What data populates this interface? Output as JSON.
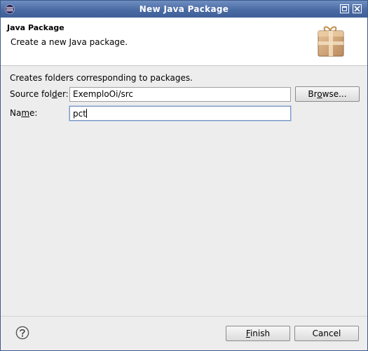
{
  "window": {
    "title": "New Java Package",
    "app_icon": "eclipse-icon",
    "maximize_icon": "maximize-icon",
    "close_icon": "close-icon"
  },
  "header": {
    "title": "Java Package",
    "description": "Create a new Java package.",
    "icon": "package-icon"
  },
  "form": {
    "intro": "Creates folders corresponding to packages.",
    "source_folder": {
      "label_pre": "Source fol",
      "label_mnemonic": "d",
      "label_post": "er:",
      "value": "ExemploOi/src"
    },
    "name": {
      "label_pre": "Na",
      "label_mnemonic": "m",
      "label_post": "e:",
      "value": "pct"
    },
    "browse_button": {
      "pre": "Br",
      "mnemonic": "o",
      "post": "wse..."
    }
  },
  "footer": {
    "help_icon": "help-icon",
    "finish_button": {
      "mnemonic": "F",
      "post": "inish"
    },
    "cancel_button": "Cancel"
  },
  "colors": {
    "titlebar": "#4a6aa3",
    "dialog_bg": "#ededed",
    "header_bg": "#ffffff",
    "focus_border": "#7a96c2"
  }
}
